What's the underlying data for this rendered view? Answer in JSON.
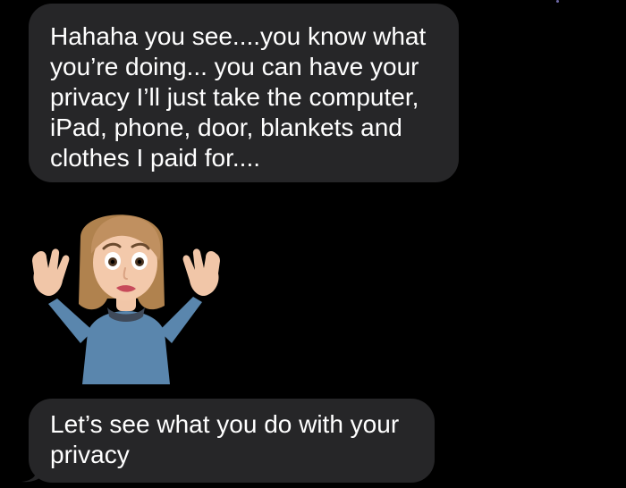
{
  "messages": [
    {
      "sender": "received",
      "text": "Hahaha you see....you know what you’re doing... you can have your privacy I’ll just take the computer, iPad, phone, door, blankets and clothes I paid for...."
    },
    {
      "sender": "received",
      "type": "memoji-sticker",
      "icon": "shrugging-memoji-icon"
    },
    {
      "sender": "received",
      "text": "Let’s see what you do with your privacy"
    }
  ],
  "colors": {
    "background": "#000000",
    "bubble_received": "#262628",
    "text": "#ffffff"
  }
}
